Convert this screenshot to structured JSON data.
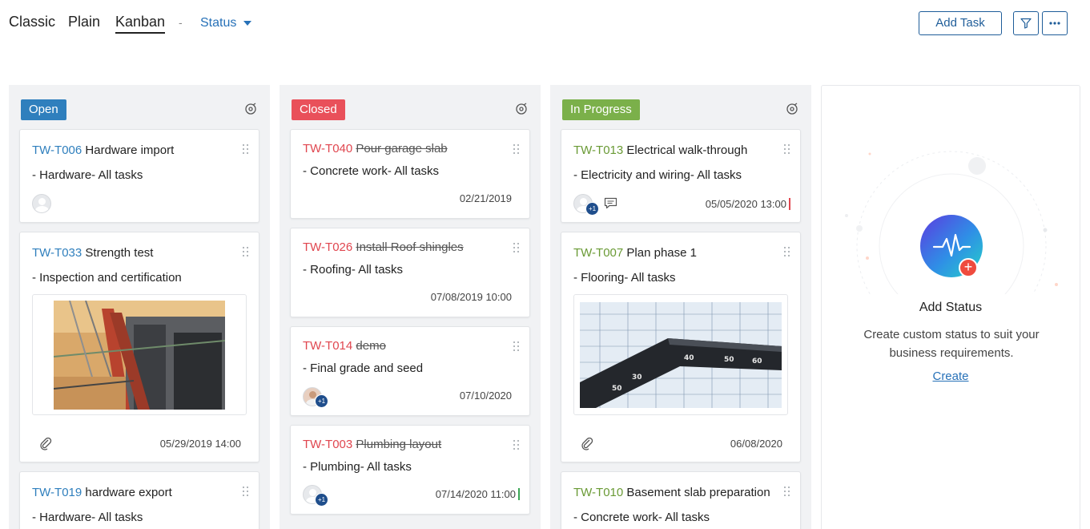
{
  "views": {
    "classic": "Classic",
    "plain": "Plain",
    "kanban": "Kanban",
    "separator": "-",
    "group_by": "Status"
  },
  "toolbar": {
    "add_task": "Add Task",
    "filter_icon": "filter-icon",
    "more_icon": "more-icon"
  },
  "colors": {
    "open": "#2f7fbd",
    "closed": "#e0464f",
    "in_progress": "#6a9a35",
    "accent": "#1f5d99"
  },
  "columns": [
    {
      "label": "Open",
      "cards": [
        {
          "id": "TW-T006",
          "name": "Hardware import",
          "list": "- Hardware- All tasks"
        },
        {
          "id": "TW-T033",
          "name": "Strength test",
          "list": "- Inspection and certification",
          "date": "05/29/2019 14:00"
        },
        {
          "id": "TW-T019",
          "name": "hardware export",
          "list": "- Hardware- All tasks"
        }
      ]
    },
    {
      "label": "Closed",
      "cards": [
        {
          "id": "TW-T040",
          "name": "Pour garage slab",
          "list": "- Concrete work- All tasks",
          "date": "02/21/2019"
        },
        {
          "id": "TW-T026",
          "name": "Install Roof shingles",
          "list": "- Roofing- All tasks",
          "date": "07/08/2019 10:00"
        },
        {
          "id": "TW-T014",
          "name": "demo",
          "list": "- Final grade and seed",
          "date": "07/10/2020",
          "extra": "+1"
        },
        {
          "id": "TW-T003",
          "name": "Plumbing layout",
          "list": "- Plumbing- All tasks",
          "date": "07/14/2020 11:00",
          "extra": "+1"
        }
      ]
    },
    {
      "label": "In Progress",
      "cards": [
        {
          "id": "TW-T013",
          "name": "Electrical walk-through",
          "list": "- Electricity and wiring- All tasks",
          "date": "05/05/2020 13:00",
          "extra": "+1"
        },
        {
          "id": "TW-T007",
          "name": "Plan phase 1",
          "list": "- Flooring- All tasks",
          "date": "06/08/2020"
        },
        {
          "id": "TW-T010",
          "name": "Basement slab preparation",
          "list": "- Concrete work- All tasks"
        }
      ]
    }
  ],
  "add_status": {
    "title": "Add Status",
    "description": "Create custom status to suit your business requirements.",
    "link": "Create"
  }
}
